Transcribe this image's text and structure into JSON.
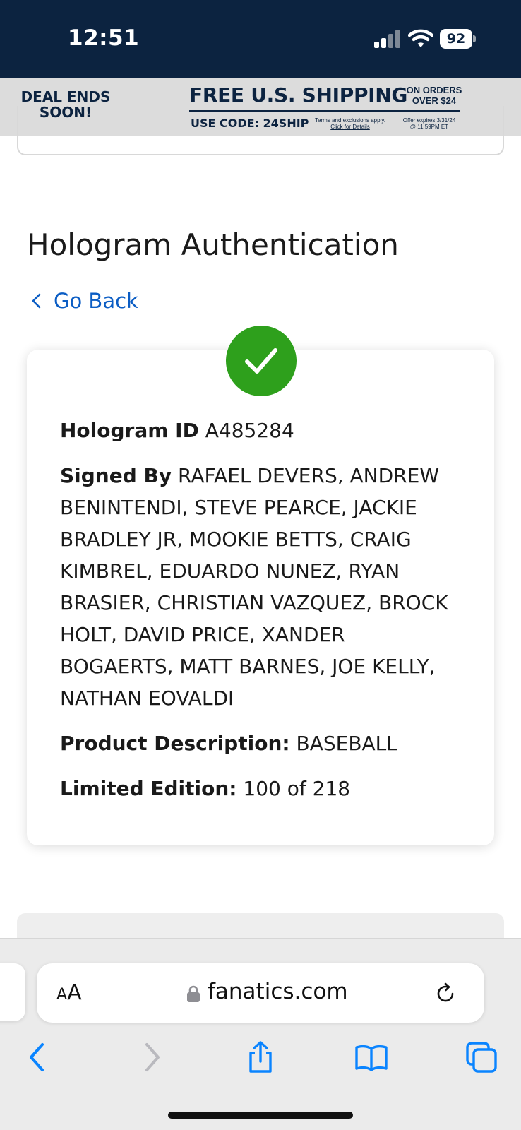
{
  "status_bar": {
    "time": "12:51",
    "battery": "92",
    "icons": [
      "signal-icon",
      "wifi-icon",
      "battery-icon"
    ]
  },
  "promo": {
    "deal": "DEAL ENDS SOON!",
    "headline": "FREE U.S. SHIPPING",
    "orders_line1": "ON ORDERS",
    "orders_line2": "OVER $24",
    "code": "USE CODE: 24SHIP",
    "terms": "Terms and exclusions apply.",
    "details_link": "Click for Details",
    "expiry_line1": "Offer expires 3/31/24",
    "expiry_line2": "@ 11:59PM ET"
  },
  "page": {
    "title": "Hologram Authentication",
    "go_back": "Go Back"
  },
  "card": {
    "status_icon": "check-icon",
    "hologram_label": "Hologram ID",
    "hologram_value": "A485284",
    "signed_label": "Signed By",
    "signed_value": "RAFAEL DEVERS, ANDREW BENINTENDI, STEVE PEARCE, JACKIE BRADLEY JR, MOOKIE BETTS, CRAIG KIMBREL, EDUARDO NUNEZ, RYAN BRASIER, CHRISTIAN VAZQUEZ, BROCK HOLT, DAVID PRICE, XANDER BOGAERTS, MATT BARNES, JOE KELLY, NATHAN EOVALDI",
    "product_label": "Product Description:",
    "product_value": "BASEBALL",
    "edition_label": "Limited Edition:",
    "edition_value": "100 of 218"
  },
  "browser": {
    "aa_small": "A",
    "aa_big": "A",
    "url": "fanatics.com",
    "toolbar": [
      "back-icon",
      "forward-icon",
      "share-icon",
      "bookmarks-icon",
      "tabs-icon"
    ]
  },
  "colors": {
    "status_bar_bg": "#0c2340",
    "promo_bg": "#dcdcdc",
    "link": "#0b5dc4",
    "success": "#2ea01c",
    "toolbar_icon": "#0a84ff"
  }
}
